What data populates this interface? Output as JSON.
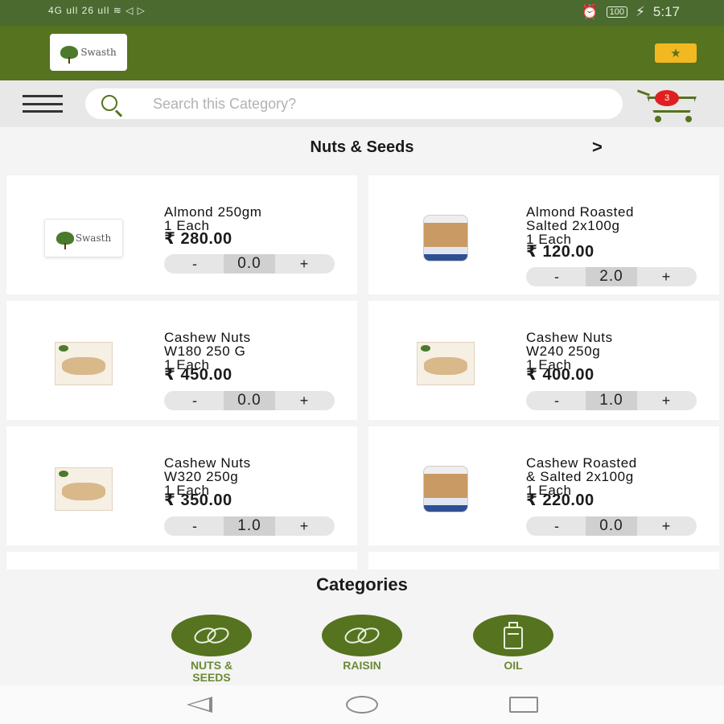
{
  "status_bar": {
    "left_text": "4G ull 26 ull ≋ ◁ ▷",
    "alarm_icon": "⏰",
    "battery": "100",
    "time": "5:17"
  },
  "header": {
    "logo_text": "Swasth",
    "offer_icon": "star-ticket-icon",
    "colors": {
      "primary": "#56731f",
      "status_bar": "#4a6a30",
      "offer": "#f2b820",
      "badge": "#e02020"
    }
  },
  "search": {
    "placeholder": "Search this Category?",
    "value": "",
    "cart_count": "3"
  },
  "category": {
    "title": "Nuts & Seeds",
    "next_glyph": ">"
  },
  "products": [
    {
      "name": "Almond 250gm",
      "qty": "1 Each",
      "price": "₹ 280.00",
      "count": "0.0",
      "image": "swasth-logo-placeholder"
    },
    {
      "name": "Almond Roasted\nSalted 2x100g",
      "qty": "1 Each",
      "price": "₹ 120.00",
      "count": "2.0",
      "image": "almond-jar"
    },
    {
      "name": "Cashew Nuts\nW180 250 G",
      "qty": "1 Each",
      "price": "₹ 450.00",
      "count": "0.0",
      "image": "cashew-box"
    },
    {
      "name": "Cashew Nuts\nW240 250g",
      "qty": "1 Each",
      "price": "₹ 400.00",
      "count": "1.0",
      "image": "cashew-box"
    },
    {
      "name": "Cashew Nuts\nW320 250g",
      "qty": "1 Each",
      "price": "₹ 350.00",
      "count": "1.0",
      "image": "cashew-box"
    },
    {
      "name": "Cashew Roasted\n& Salted 2x100g",
      "qty": "1 Each",
      "price": "₹ 220.00",
      "count": "0.0",
      "image": "cashew-jar"
    }
  ],
  "stepper": {
    "minus": "-",
    "plus": "+"
  },
  "categories": {
    "title": "Categories",
    "items": [
      {
        "label": "NUTS &\nSEEDS",
        "icon": "nuts-icon"
      },
      {
        "label": "RAISIN",
        "icon": "raisin-icon"
      },
      {
        "label": "OIL",
        "icon": "oil-can-icon"
      }
    ]
  }
}
